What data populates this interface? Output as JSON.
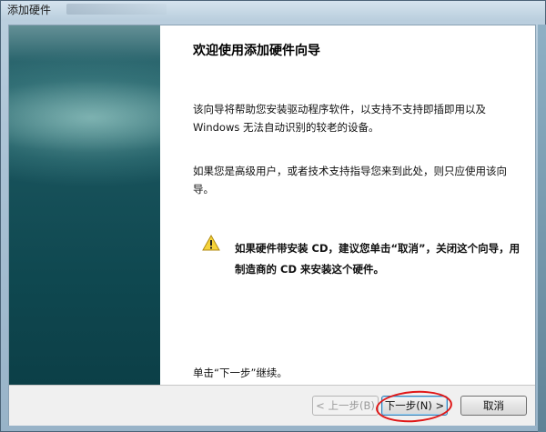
{
  "window": {
    "title": "添加硬件"
  },
  "wizard": {
    "heading": "欢迎使用添加硬件向导",
    "intro": "该向导将帮助您安装驱动程序软件，以支持不支持即插即用以及 Windows 无法自动识别的较老的设备。",
    "advanced_note": "如果您是高级用户，或者技术支持指导您来到此处，则只应使用该向导。",
    "warning": "如果硬件带安装 CD，建议您单击“取消”，关闭这个向导，用制造商的 CD 来安装这个硬件。",
    "continue_hint": "单击“下一步”继续。"
  },
  "buttons": {
    "back": "< 上一步(B)",
    "next": "下一步(N) >",
    "cancel": "取消"
  },
  "icons": {
    "warning": "warning-icon"
  },
  "colors": {
    "banner": "#19535c",
    "annotation": "#e01818"
  }
}
